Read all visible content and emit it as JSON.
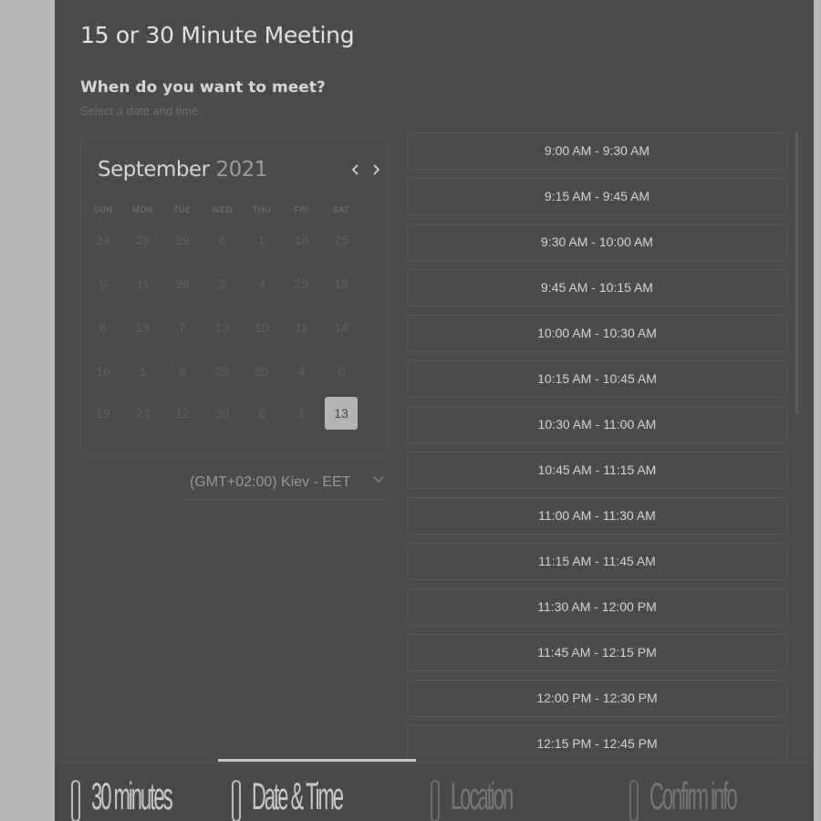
{
  "page": {
    "title": "15 or 30 Minute Meeting",
    "question": "When do you want to meet?",
    "hint": "Select a date and time"
  },
  "calendar": {
    "month": "September",
    "year": "2021",
    "prev_icon": "chevron-left-icon",
    "next_icon": "chevron-right-icon",
    "weekdays": [
      "SUN",
      "MON",
      "TUE",
      "WED",
      "THU",
      "FRI",
      "SAT"
    ],
    "weeks": [
      [
        "24",
        "26",
        "29",
        "6",
        "1",
        "18",
        "25"
      ],
      [
        "5",
        "11",
        "26",
        "3",
        "4",
        "29",
        "18"
      ],
      [
        "6",
        "19",
        "7",
        "13",
        "10",
        "11",
        "14"
      ],
      [
        "16",
        "1",
        "6",
        "25",
        "25",
        "4",
        "6"
      ],
      [
        "19",
        "23",
        "12",
        "30",
        "6",
        "1",
        "13"
      ]
    ],
    "selected_day": "13"
  },
  "timezone": {
    "label": "(GMT+02:00) Kiev - EET",
    "icon": "chevron-down-icon"
  },
  "time_slots": [
    "9:00 AM - 9:30 AM",
    "9:15 AM - 9:45 AM",
    "9:30 AM - 10:00 AM",
    "9:45 AM - 10:15 AM",
    "10:00 AM - 10:30 AM",
    "10:15 AM - 10:45 AM",
    "10:30 AM - 11:00 AM",
    "10:45 AM - 11:15 AM",
    "11:00 AM - 11:30 AM",
    "11:15 AM - 11:45 AM",
    "11:30 AM - 12:00 PM",
    "11:45 AM - 12:15 PM",
    "12:00 PM - 12:30 PM",
    "12:15 PM - 12:45 PM"
  ],
  "steps": [
    {
      "label": "30 minutes",
      "active": false,
      "dim": false
    },
    {
      "label": "Date & Time",
      "active": true,
      "dim": false
    },
    {
      "label": "Location",
      "active": false,
      "dim": true
    },
    {
      "label": "Confirm info",
      "active": false,
      "dim": true
    }
  ],
  "colors": {
    "panel": "#4a4a4a",
    "backdrop": "#b9b9b9",
    "selected_day_bg": "#b4b4b4",
    "text": "#d6d6d6"
  }
}
